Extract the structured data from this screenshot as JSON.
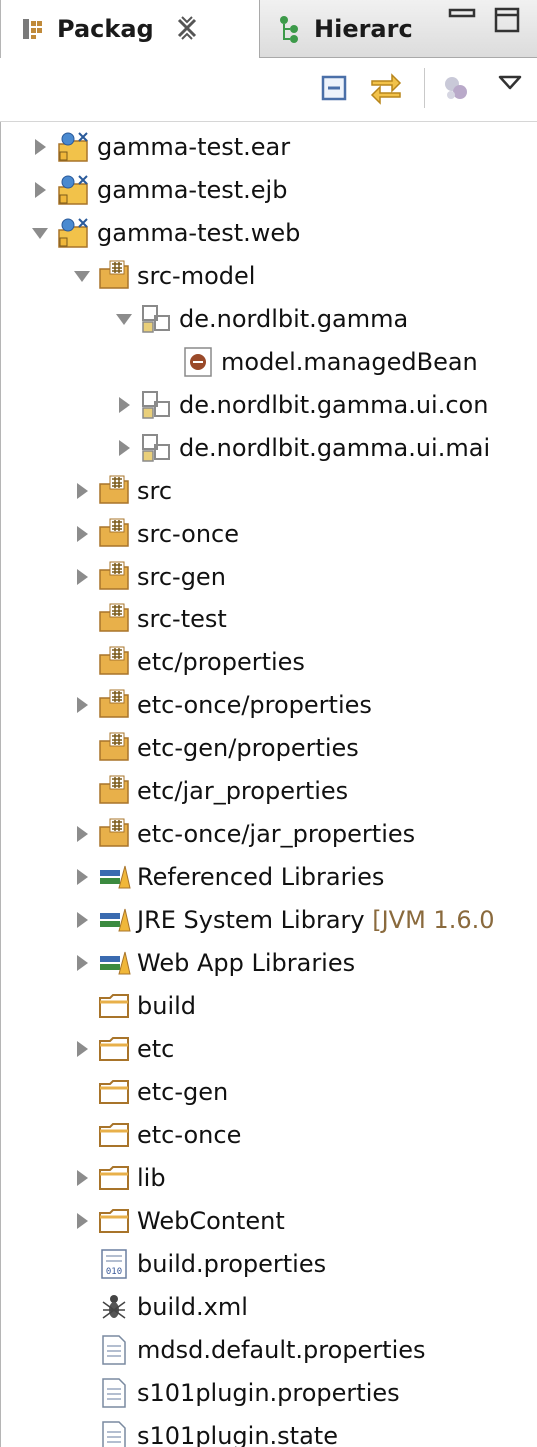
{
  "tabs": [
    {
      "label": "Packag",
      "active": true,
      "icon": "package-explorer-icon"
    },
    {
      "label": "Hierarc",
      "active": false,
      "icon": "hierarchy-icon"
    }
  ],
  "toolbar": {
    "buttons": [
      {
        "name": "collapse-all-icon"
      },
      {
        "name": "link-with-editor-icon"
      },
      {
        "name": "focus-task-icon"
      },
      {
        "name": "view-menu-chevron-icon"
      }
    ]
  },
  "colors": {
    "folder": "#e8b04a",
    "package": "#8a8a8a",
    "library": "#3a6bb0",
    "file": "#ffffff",
    "twisty": "#8c8c8c"
  },
  "tree": [
    {
      "label": "gamma-test.ear",
      "level": 0,
      "expander": "collapsed",
      "icon": "ear-project-icon"
    },
    {
      "label": "gamma-test.ejb",
      "level": 0,
      "expander": "collapsed",
      "icon": "ejb-project-icon"
    },
    {
      "label": "gamma-test.web",
      "level": 0,
      "expander": "expanded",
      "icon": "web-project-icon"
    },
    {
      "label": "src-model",
      "level": 1,
      "expander": "expanded",
      "icon": "source-folder-icon"
    },
    {
      "label": "de.nordlbit.gamma",
      "level": 2,
      "expander": "expanded",
      "icon": "package-icon"
    },
    {
      "label": "model.managedBean",
      "level": 3,
      "expander": "none",
      "icon": "model-file-icon"
    },
    {
      "label": "de.nordlbit.gamma.ui.con",
      "level": 2,
      "expander": "collapsed",
      "icon": "package-icon"
    },
    {
      "label": "de.nordlbit.gamma.ui.mai",
      "level": 2,
      "expander": "collapsed",
      "icon": "package-icon"
    },
    {
      "label": "src",
      "level": 1,
      "expander": "collapsed",
      "icon": "source-folder-icon"
    },
    {
      "label": "src-once",
      "level": 1,
      "expander": "collapsed",
      "icon": "source-folder-icon"
    },
    {
      "label": "src-gen",
      "level": 1,
      "expander": "collapsed",
      "icon": "source-folder-icon"
    },
    {
      "label": "src-test",
      "level": 1,
      "expander": "none",
      "icon": "source-folder-icon"
    },
    {
      "label": "etc/properties",
      "level": 1,
      "expander": "none",
      "icon": "source-folder-icon"
    },
    {
      "label": "etc-once/properties",
      "level": 1,
      "expander": "collapsed",
      "icon": "source-folder-icon"
    },
    {
      "label": "etc-gen/properties",
      "level": 1,
      "expander": "none",
      "icon": "source-folder-icon"
    },
    {
      "label": "etc/jar_properties",
      "level": 1,
      "expander": "none",
      "icon": "source-folder-icon"
    },
    {
      "label": "etc-once/jar_properties",
      "level": 1,
      "expander": "collapsed",
      "icon": "source-folder-icon"
    },
    {
      "label": "Referenced Libraries",
      "level": 1,
      "expander": "collapsed",
      "icon": "library-icon"
    },
    {
      "label": "JRE System Library",
      "suffix": " [JVM 1.6.0",
      "level": 1,
      "expander": "collapsed",
      "icon": "library-icon"
    },
    {
      "label": "Web App Libraries",
      "level": 1,
      "expander": "collapsed",
      "icon": "library-icon"
    },
    {
      "label": "build",
      "level": 1,
      "expander": "none",
      "icon": "folder-icon"
    },
    {
      "label": "etc",
      "level": 1,
      "expander": "collapsed",
      "icon": "folder-icon"
    },
    {
      "label": "etc-gen",
      "level": 1,
      "expander": "none",
      "icon": "folder-icon"
    },
    {
      "label": "etc-once",
      "level": 1,
      "expander": "none",
      "icon": "folder-icon"
    },
    {
      "label": "lib",
      "level": 1,
      "expander": "collapsed",
      "icon": "folder-icon"
    },
    {
      "label": "WebContent",
      "level": 1,
      "expander": "collapsed",
      "icon": "folder-icon"
    },
    {
      "label": "build.properties",
      "level": 1,
      "expander": "none",
      "icon": "properties-file-icon"
    },
    {
      "label": "build.xml",
      "level": 1,
      "expander": "none",
      "icon": "ant-file-icon"
    },
    {
      "label": "mdsd.default.properties",
      "level": 1,
      "expander": "none",
      "icon": "text-file-icon"
    },
    {
      "label": "s101plugin.properties",
      "level": 1,
      "expander": "none",
      "icon": "text-file-icon"
    },
    {
      "label": "s101plugin.state",
      "level": 1,
      "expander": "none",
      "icon": "text-file-icon"
    }
  ]
}
